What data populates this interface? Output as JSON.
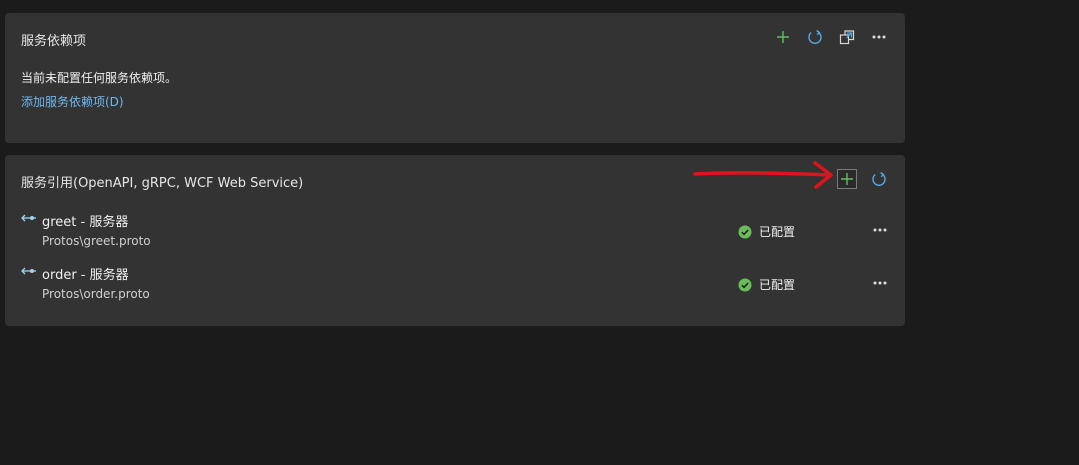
{
  "dependencies": {
    "title": "服务依赖项",
    "empty_text": "当前未配置任何服务依赖项。",
    "add_link": "添加服务依赖项(D)",
    "toolbar_icons": [
      "add-icon",
      "refresh-icon",
      "manage-icon",
      "more-icon"
    ]
  },
  "references": {
    "title": "服务引用(OpenAPI, gRPC, WCF Web Service)",
    "toolbar_icons": [
      "add-icon",
      "refresh-icon"
    ],
    "items": [
      {
        "name": "greet - 服务器",
        "path": "Protos\\greet.proto",
        "status": "已配置",
        "icon": "service-connection-icon"
      },
      {
        "name": "order - 服务器",
        "path": "Protos\\order.proto",
        "status": "已配置",
        "icon": "service-connection-icon"
      }
    ]
  },
  "colors": {
    "accent_link": "#6fb7ef",
    "add_green": "#5fbf60",
    "refresh_blue": "#56a8e6",
    "status_green": "#6bbd5b",
    "annotation_red": "#e0131c"
  },
  "annotation": {
    "type": "red-arrow",
    "points_to": "references-add-button"
  }
}
